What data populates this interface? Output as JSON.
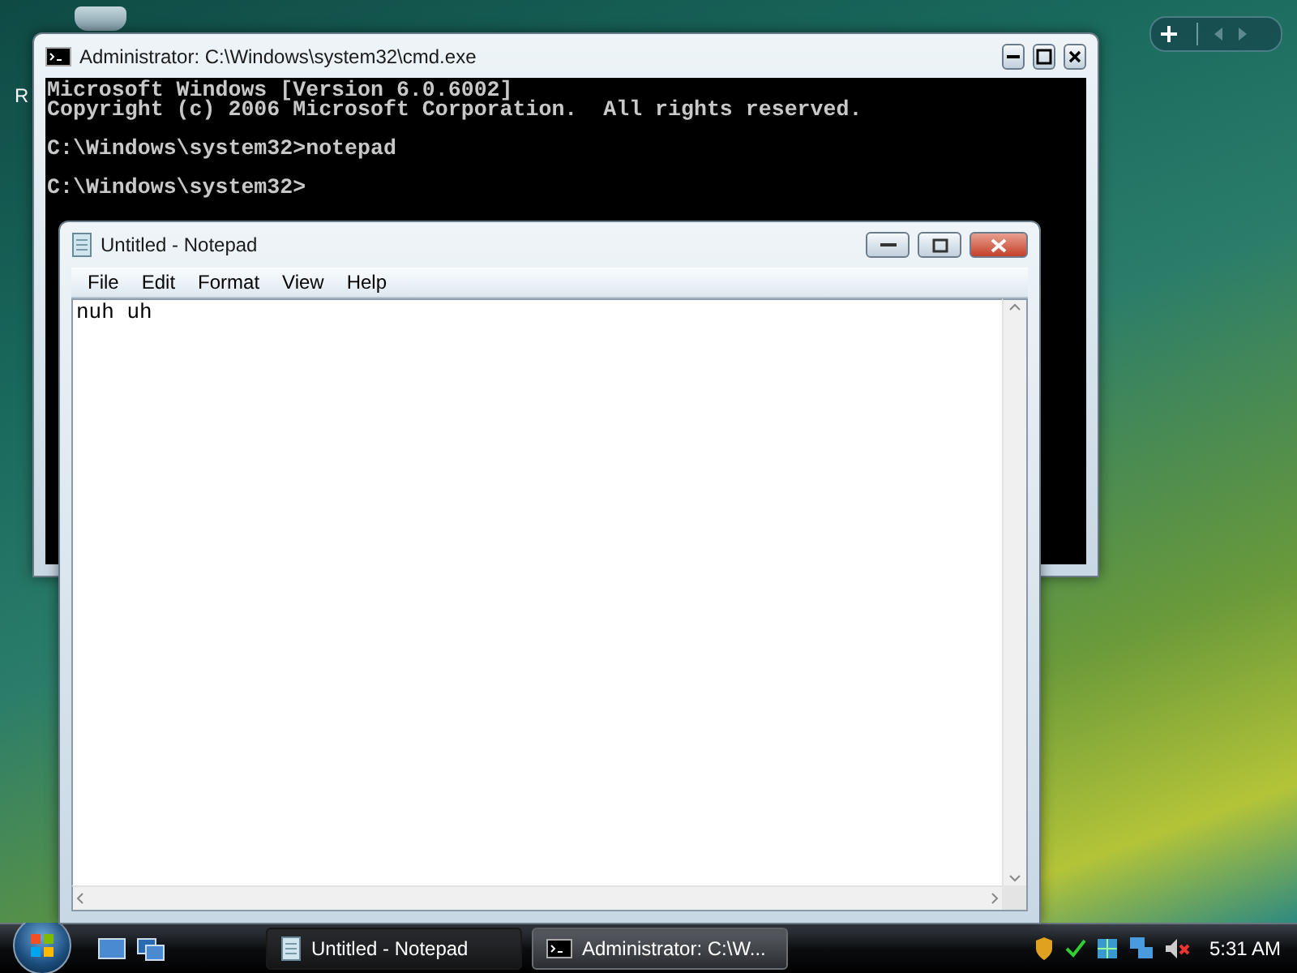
{
  "desktop": {
    "icon_label": "R"
  },
  "cmd_window": {
    "title": "Administrator: C:\\Windows\\system32\\cmd.exe",
    "paragraphs": [
      [
        "Microsoft Windows [Version 6.0.6002]",
        "Copyright (c) 2006 Microsoft Corporation.  All rights reserved."
      ],
      [
        "C:\\Windows\\system32>notepad"
      ],
      [
        "C:\\Windows\\system32>"
      ]
    ]
  },
  "notepad": {
    "title": "Untitled - Notepad",
    "menu": [
      "File",
      "Edit",
      "Format",
      "View",
      "Help"
    ],
    "text": "nuh uh"
  },
  "taskbar": {
    "tasks": [
      {
        "label": "Untitled - Notepad",
        "selected": true,
        "kind": "notepad"
      },
      {
        "label": "Administrator: C:\\W...",
        "selected": false,
        "kind": "console"
      }
    ],
    "clock": "5:31 AM"
  }
}
